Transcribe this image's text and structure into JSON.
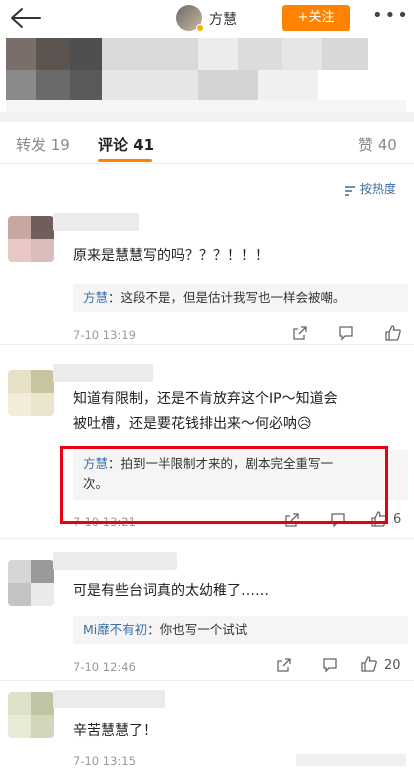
{
  "header": {
    "author": "方慧",
    "follow_label": "+关注",
    "more_label": "•••"
  },
  "tabs": [
    {
      "label": "转发 19"
    },
    {
      "label": "评论 41"
    },
    {
      "label": "赞 40"
    }
  ],
  "sort_label": "按热度",
  "comments": [
    {
      "text": "原来是慧慧写的吗？？？！！！",
      "reply_name": "方慧",
      "reply_text": "这段不是，但是估计我写也一样会被嘲。",
      "time": "7-10 13:19",
      "likes": ""
    },
    {
      "text_line1": "知道有限制，还是不肯放弃这个IP～知道会",
      "text_line2": "被吐槽，还是要花钱排出来～何必呐😥",
      "reply_name": "方慧",
      "reply_line1": "拍到一半限制才来的，剧本完全重写一",
      "reply_line2": "次。",
      "time": "7-10 13:21",
      "likes": "6"
    },
    {
      "text": "可是有些台词真的太幼稚了……",
      "reply_name": "Mi靡不有初",
      "reply_text": "你也写一个试试",
      "time": "7-10 12:46",
      "likes": "20"
    },
    {
      "text": "辛苦慧慧了！",
      "time": "7-10 13:15",
      "likes": ""
    }
  ],
  "colors": {
    "accent": "#ff8200",
    "link": "#3a6ea5",
    "highlight_box": "#e50012"
  }
}
